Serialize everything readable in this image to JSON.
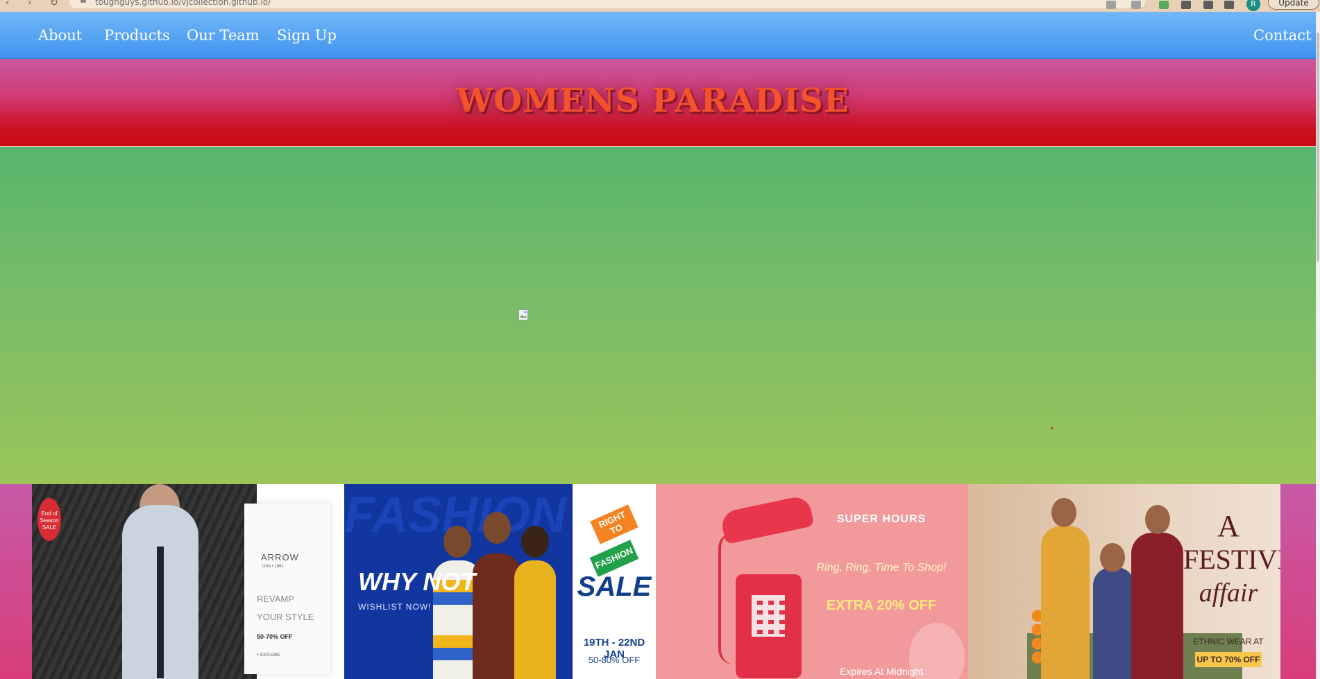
{
  "browser": {
    "url": "toughguys.github.io/vjcollection.github.io/",
    "update_label": "Update",
    "profile_initial": "R"
  },
  "nav": {
    "left_links": [
      "About",
      "Products",
      "Our Team",
      "Sign Up"
    ],
    "right_link": "Contact"
  },
  "header": {
    "title": "WOMENS PARADISE"
  },
  "banners": {
    "arrow": {
      "sale_badge": "End of Season SALE",
      "brand": "ARROW",
      "brand_sub": "USA • 1851",
      "headline_1": "REVAMP",
      "headline_2": "YOUR STYLE",
      "discount": "50-70% OFF",
      "footnote": "+ EXPLORE"
    },
    "whynot": {
      "background_words": "FASHION FASHION RULES",
      "headline": "WHY NOT",
      "subline": "WISHLIST NOW!"
    },
    "fashion_sale": {
      "tag_1": "RIGHT TO",
      "tag_2": "FASHION",
      "headline": "SALE",
      "dates": "19TH - 22ND JAN",
      "discount": "50-80% OFF"
    },
    "super_hours": {
      "headline": "SUPER HOURS",
      "tagline": "Ring, Ring, Time To Shop!",
      "offer": "EXTRA 20% OFF",
      "expiry": "Expires At Midnight"
    },
    "festive": {
      "line_1": "A",
      "line_2": "FESTIVE",
      "line_3": "affair",
      "ethnic": "ETHNIC WEAR AT",
      "offer": "UP TO 70% OFF"
    }
  },
  "colors": {
    "navbar": "#4a9cf0",
    "header_title": "#f4512d",
    "hero_top": "#58b66e",
    "hero_bottom": "#9bc55a"
  }
}
